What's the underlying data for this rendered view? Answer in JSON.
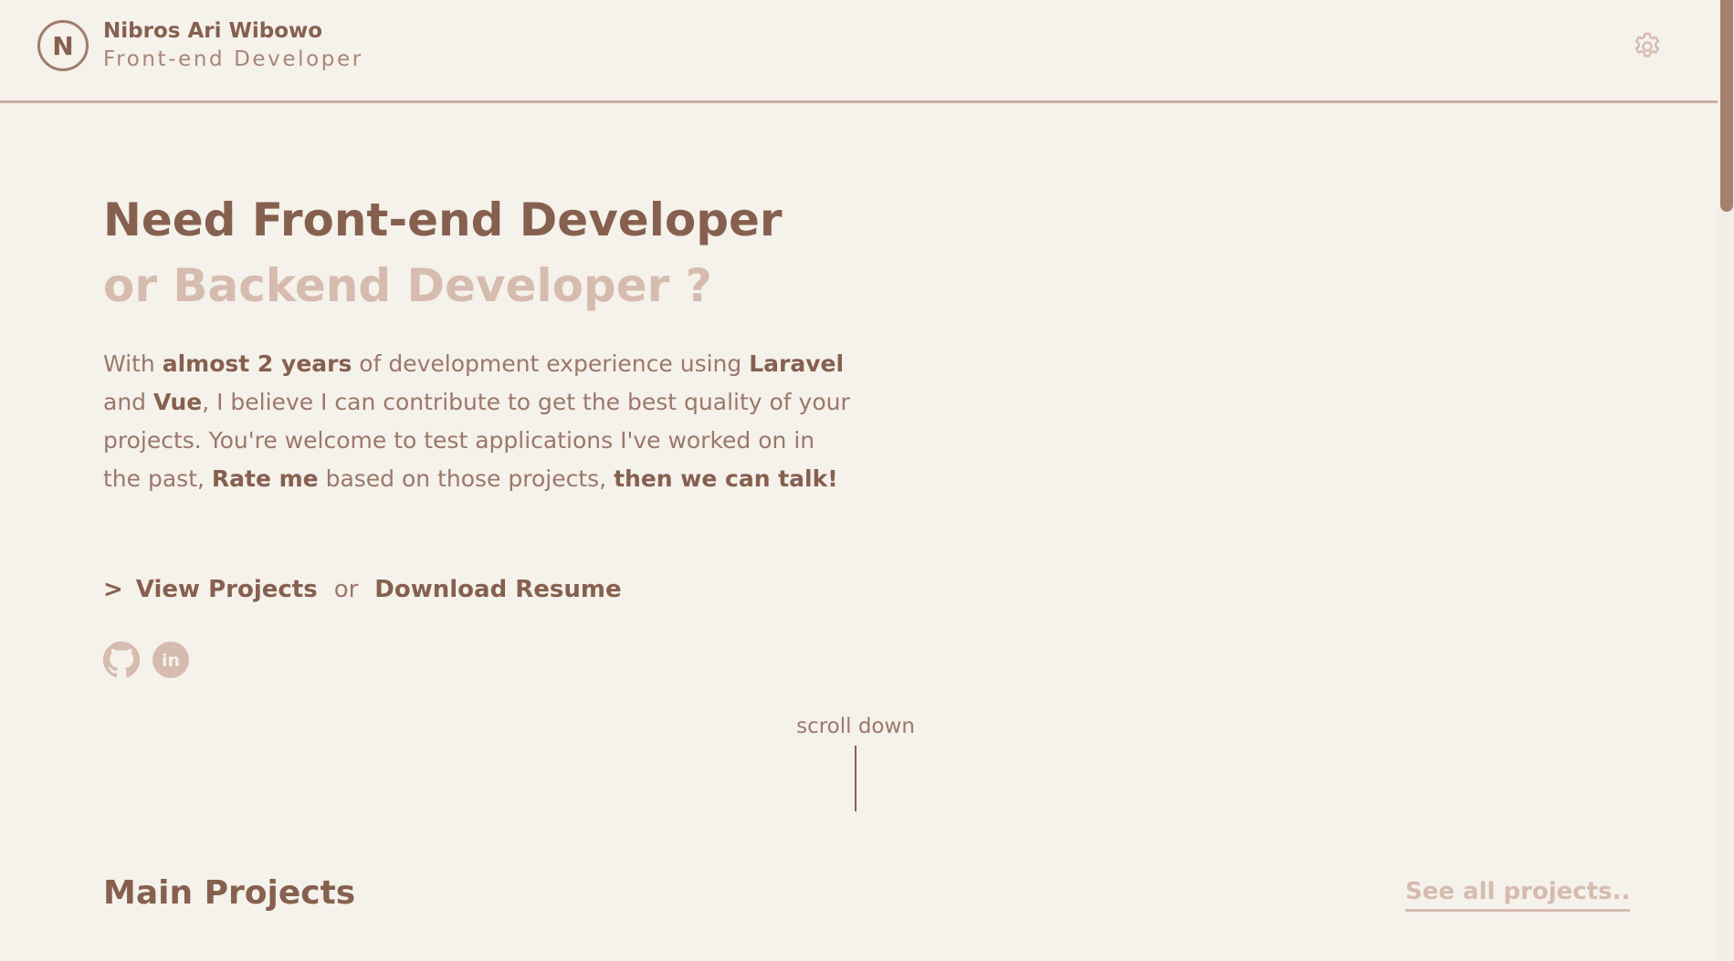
{
  "header": {
    "logo_letter": "N",
    "name": "Nibros Ari Wibowo",
    "role": "Front-end Developer",
    "settings_icon": "gear-icon"
  },
  "hero": {
    "title_line1": "Need Front-end Developer",
    "title_line2": "or Backend Developer ?",
    "text": {
      "p1": "With ",
      "b1": "almost 2 years",
      "p2": " of development experience using ",
      "b2": "Laravel",
      "p3": " and ",
      "b3": "Vue",
      "p4": ", I believe I can contribute to get the best quality of your projects. You're welcome to test applications I've worked on in the past, ",
      "b4": "Rate me",
      "p5": " based on those projects, ",
      "b5": "then we can talk!"
    },
    "cta": {
      "chevron": ">",
      "view_projects": "View Projects",
      "or": "or",
      "download_resume": "Download Resume"
    },
    "socials": [
      {
        "icon": "github-icon"
      },
      {
        "icon": "linkedin-icon",
        "glyph": "in"
      }
    ]
  },
  "scroll_hint": "scroll down",
  "projects": {
    "title": "Main Projects",
    "see_all": "See all projects.."
  },
  "colors": {
    "background": "#f5f1eb",
    "primary": "#86604f",
    "accent": "#d6bbaf",
    "muted": "#9b786a"
  }
}
